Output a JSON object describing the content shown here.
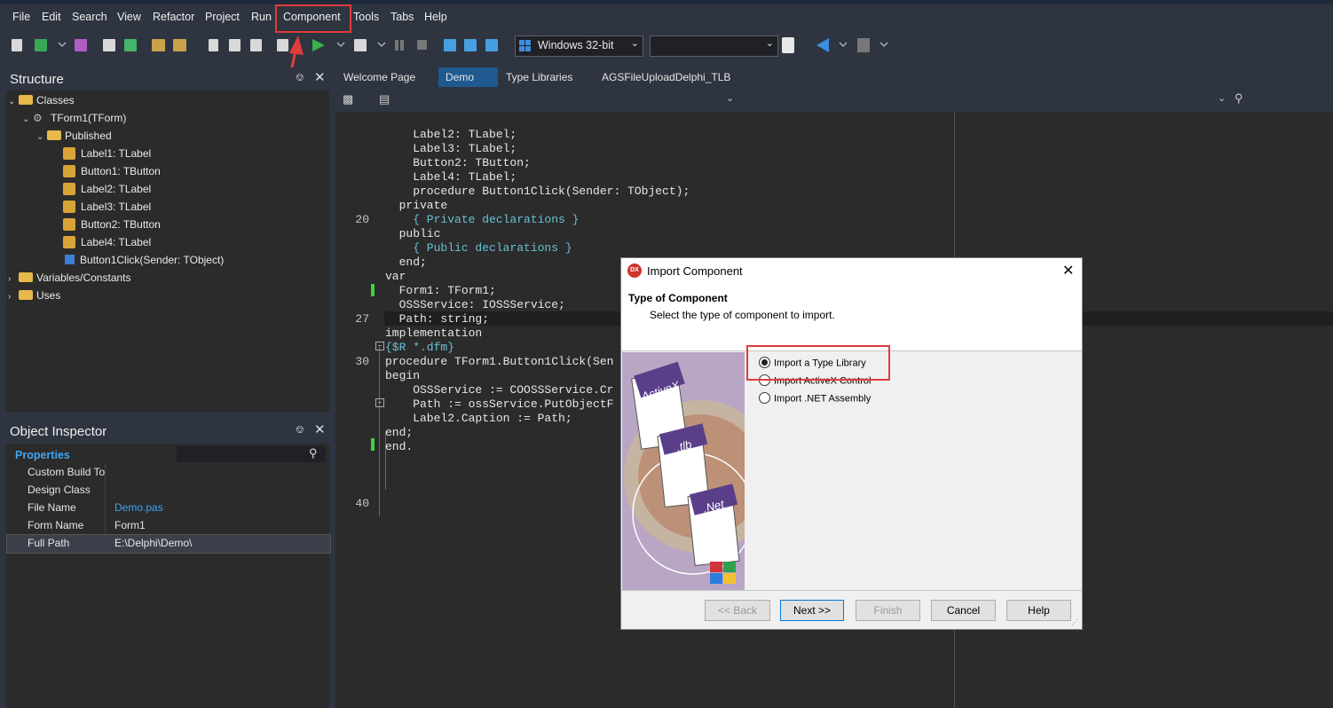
{
  "menu": [
    "File",
    "Edit",
    "Search",
    "View",
    "Refactor",
    "Project",
    "Run",
    "Component",
    "Tools",
    "Tabs",
    "Help"
  ],
  "toolbar": {
    "platform": "Windows 32-bit",
    "config": ""
  },
  "structure": {
    "title": "Structure",
    "tree": [
      {
        "label": "Classes",
        "type": "folder",
        "level": 0,
        "expanded": true
      },
      {
        "label": "TForm1(TForm)",
        "type": "class",
        "level": 1,
        "expanded": true
      },
      {
        "label": "Published",
        "type": "folder",
        "level": 2,
        "expanded": true
      },
      {
        "label": "Label1: TLabel",
        "type": "comp",
        "level": 3
      },
      {
        "label": "Button1: TButton",
        "type": "comp",
        "level": 3
      },
      {
        "label": "Label2: TLabel",
        "type": "comp",
        "level": 3
      },
      {
        "label": "Label3: TLabel",
        "type": "comp",
        "level": 3
      },
      {
        "label": "Button2: TButton",
        "type": "comp",
        "level": 3
      },
      {
        "label": "Label4: TLabel",
        "type": "comp",
        "level": 3
      },
      {
        "label": "Button1Click(Sender: TObject)",
        "type": "method",
        "level": 3
      },
      {
        "label": "Variables/Constants",
        "type": "folder",
        "level": 0,
        "expanded": false
      },
      {
        "label": "Uses",
        "type": "folder",
        "level": 0,
        "expanded": false
      }
    ]
  },
  "inspector": {
    "title": "Object Inspector",
    "tab": "Properties",
    "rows": [
      {
        "name": "Custom Build To",
        "value": ""
      },
      {
        "name": "Design Class",
        "value": ""
      },
      {
        "name": "File Name",
        "value": "Demo.pas"
      },
      {
        "name": "Form Name",
        "value": "Form1"
      },
      {
        "name": "Full Path",
        "value": "E:\\Delphi\\Demo\\"
      }
    ]
  },
  "tabs": [
    "Welcome Page",
    "Demo",
    "Type Libraries",
    "AGSFileUploadDelphi_TLB"
  ],
  "code": {
    "line_numbers": [
      "20",
      "27",
      "30",
      "40"
    ],
    "lines": [
      "    Label2: TLabel;",
      "    Label3: TLabel;",
      "    Button2: TButton;",
      "    Label4: TLabel;",
      "    procedure Button1Click(Sender: TObject);",
      "  private",
      "    { Private declarations }",
      "  public",
      "    { Public declarations }",
      "  end;",
      "",
      "var",
      "  Form1: TForm1;",
      "  OSSService: IOSSService;",
      "  Path: string;",
      "",
      "implementation",
      "",
      "{$R *.dfm}",
      "",
      "procedure TForm1.Button1Click(Sen",
      "",
      "begin",
      "    OSSService := COOSSService.Cr",
      "    Path := ossService.PutObjectF",
      "    Label2.Caption := Path;",
      "end;",
      "",
      "end."
    ]
  },
  "dialog": {
    "title": "Import Component",
    "icon_text": "DX",
    "heading": "Type of Component",
    "subheading": "Select the type of component to import.",
    "options": [
      "Import a Type Library",
      "Import ActiveX Control",
      "Import .NET Assembly"
    ],
    "selected": 0,
    "image_labels": [
      "ActiveX",
      ".tlb",
      ".Net"
    ],
    "buttons": {
      "back": "<< Back",
      "next": "Next >>",
      "finish": "Finish",
      "cancel": "Cancel",
      "help": "Help"
    }
  },
  "colors": {
    "highlight": "#e03c3c",
    "ide_bg": "#2b2b2b",
    "menu_bg": "#2e3440",
    "accent": "#2f8fd8"
  }
}
